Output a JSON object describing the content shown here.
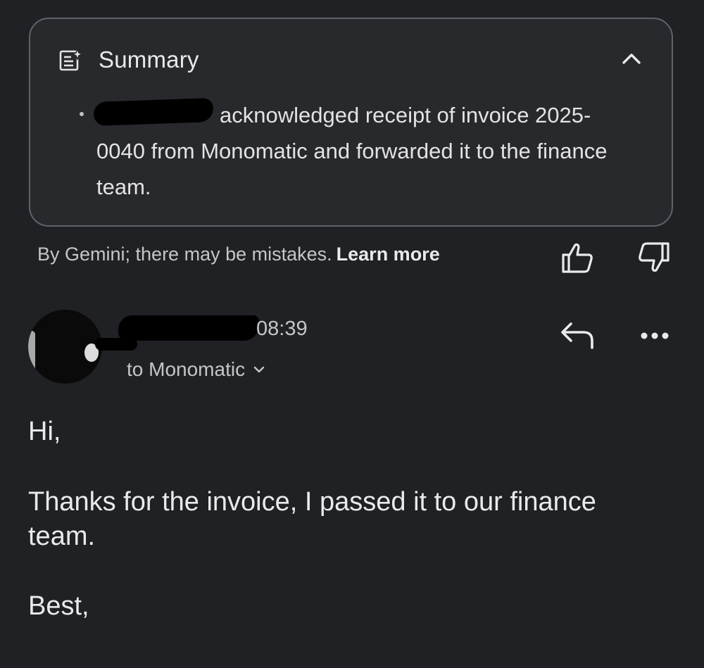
{
  "summary": {
    "title": "Summary",
    "bullet_text": "acknowledged receipt of invoice 2025-0040 from Monomatic and forwarded it to the finance team."
  },
  "disclaimer": {
    "text": "By Gemini; there may be mistakes.",
    "learn_more": "Learn more"
  },
  "message": {
    "sender_name": "",
    "time": "08:39",
    "to_line": "to Monomatic",
    "body": {
      "greeting": "Hi,",
      "line1": "Thanks for the invoice, I passed it to our finance",
      "line2": "team.",
      "signoff": "Best,"
    }
  },
  "icons": {
    "summary": "summary-sparkle-icon",
    "collapse": "chevron-up-icon",
    "thumbs_up": "thumbs-up-icon",
    "thumbs_down": "thumbs-down-icon",
    "reply": "reply-icon",
    "more": "more-horizontal-icon",
    "to_expand": "chevron-down-icon"
  },
  "colors": {
    "background": "#202124",
    "card": "#28292c",
    "border": "#5f6368",
    "text": "#e8eaed",
    "muted": "#c4c7c5"
  }
}
